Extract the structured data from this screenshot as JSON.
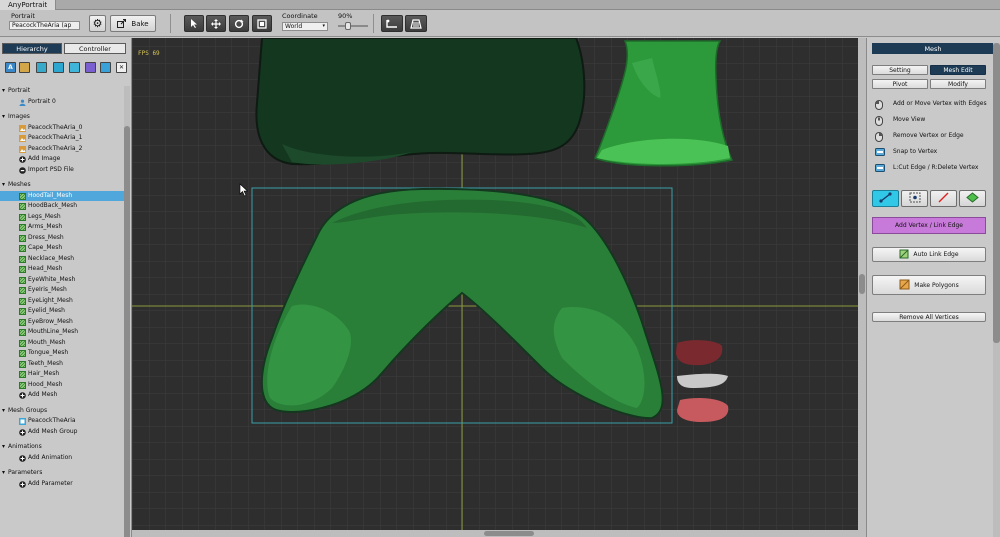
{
  "window": {
    "tab_title": "AnyPortrait"
  },
  "toolbar": {
    "portrait_label": "Portrait",
    "portrait_value": "PeacockTheAria (ap",
    "bake_label": "Bake",
    "coordinate_label": "Coordinate",
    "coordinate_value": "World",
    "zoom_label": "90%",
    "zoom_fraction": 0.3
  },
  "left_panel": {
    "tabs": {
      "hierarchy": "Hierarchy",
      "controller": "Controller"
    },
    "filter_icons": [
      "text-filter-icon",
      "image-filter-icon",
      "mesh-filter-icon",
      "meshgroup-filter-icon",
      "animation-filter-icon",
      "parameter-filter-icon",
      "portrait-filter-icon",
      "clear-filter-icon"
    ],
    "filter_first_letter": "A",
    "sections": [
      {
        "title": "Portrait",
        "items": [
          {
            "label": "Portrait 0",
            "icon": "portrait-icon"
          }
        ]
      },
      {
        "title": "Images",
        "items": [
          {
            "label": "PeacockTheAria_0",
            "icon": "image-icon"
          },
          {
            "label": "PeacockTheAria_1",
            "icon": "image-icon"
          },
          {
            "label": "PeacockTheAria_2",
            "icon": "image-icon"
          },
          {
            "label": "Add Image",
            "icon": "add-icon"
          },
          {
            "label": "Import PSD File",
            "icon": "import-icon"
          }
        ]
      },
      {
        "title": "Meshes",
        "items": [
          {
            "label": "HoodTail_Mesh",
            "icon": "mesh-icon",
            "selected": true
          },
          {
            "label": "HoodBack_Mesh",
            "icon": "mesh-icon"
          },
          {
            "label": "Legs_Mesh",
            "icon": "mesh-icon"
          },
          {
            "label": "Arms_Mesh",
            "icon": "mesh-icon"
          },
          {
            "label": "Dress_Mesh",
            "icon": "mesh-icon"
          },
          {
            "label": "Cape_Mesh",
            "icon": "mesh-icon"
          },
          {
            "label": "Necklace_Mesh",
            "icon": "mesh-icon"
          },
          {
            "label": "Head_Mesh",
            "icon": "mesh-icon"
          },
          {
            "label": "EyeWhite_Mesh",
            "icon": "mesh-icon"
          },
          {
            "label": "EyeIris_Mesh",
            "icon": "mesh-icon"
          },
          {
            "label": "EyeLight_Mesh",
            "icon": "mesh-icon"
          },
          {
            "label": "Eyelid_Mesh",
            "icon": "mesh-icon"
          },
          {
            "label": "EyeBrow_Mesh",
            "icon": "mesh-icon"
          },
          {
            "label": "MouthLine_Mesh",
            "icon": "mesh-icon"
          },
          {
            "label": "Mouth_Mesh",
            "icon": "mesh-icon"
          },
          {
            "label": "Tongue_Mesh",
            "icon": "mesh-icon"
          },
          {
            "label": "Teeth_Mesh",
            "icon": "mesh-icon"
          },
          {
            "label": "Hair_Mesh",
            "icon": "mesh-icon"
          },
          {
            "label": "Hood_Mesh",
            "icon": "mesh-icon"
          },
          {
            "label": "Add Mesh",
            "icon": "add-icon"
          }
        ]
      },
      {
        "title": "Mesh Groups",
        "items": [
          {
            "label": "PeacockTheAria",
            "icon": "meshgroup-icon"
          },
          {
            "label": "Add Mesh Group",
            "icon": "add-icon"
          }
        ]
      },
      {
        "title": "Animations",
        "items": [
          {
            "label": "Add Animation",
            "icon": "add-icon"
          }
        ]
      },
      {
        "title": "Parameters",
        "items": [
          {
            "label": "Add Parameter",
            "icon": "add-icon"
          }
        ]
      }
    ]
  },
  "viewport": {
    "fps": "FPS 69"
  },
  "right_panel": {
    "title": "Mesh",
    "tabs": {
      "setting": "Setting",
      "mesh_edit": "Mesh Edit",
      "pivot": "Pivot",
      "modify": "Modify"
    },
    "hints": [
      {
        "text": "Add or Move Vertex with Edges",
        "icon": "mouse-left-icon"
      },
      {
        "text": "Move View",
        "icon": "mouse-middle-icon"
      },
      {
        "text": "Remove Vertex or Edge",
        "icon": "mouse-right-icon"
      },
      {
        "text": "Snap to Vertex",
        "icon": "keyboard-icon"
      },
      {
        "text": "L:Cut Edge / R:Delete Vertex",
        "icon": "keyboard-icon"
      }
    ],
    "tools": [
      "add-vertex-link-tool-icon",
      "select-vertex-tool-icon",
      "link-edge-tool-icon",
      "polygon-tool-icon"
    ],
    "add_vertex_label": "Add Vertex / Link Edge",
    "auto_link_label": "Auto Link Edge",
    "make_polygons_label": "Make Polygons",
    "remove_all_label": "Remove All Vertices"
  },
  "colors": {
    "panel_header": "#1d3b54",
    "selection": "#4fa7db",
    "active_tool": "#31c7e6",
    "add_vertex_button": "#c77ad9",
    "viewport_bg": "#2f2f2f",
    "mesh_green": "#2f8a3e",
    "fps_text": "#d6c45a"
  }
}
